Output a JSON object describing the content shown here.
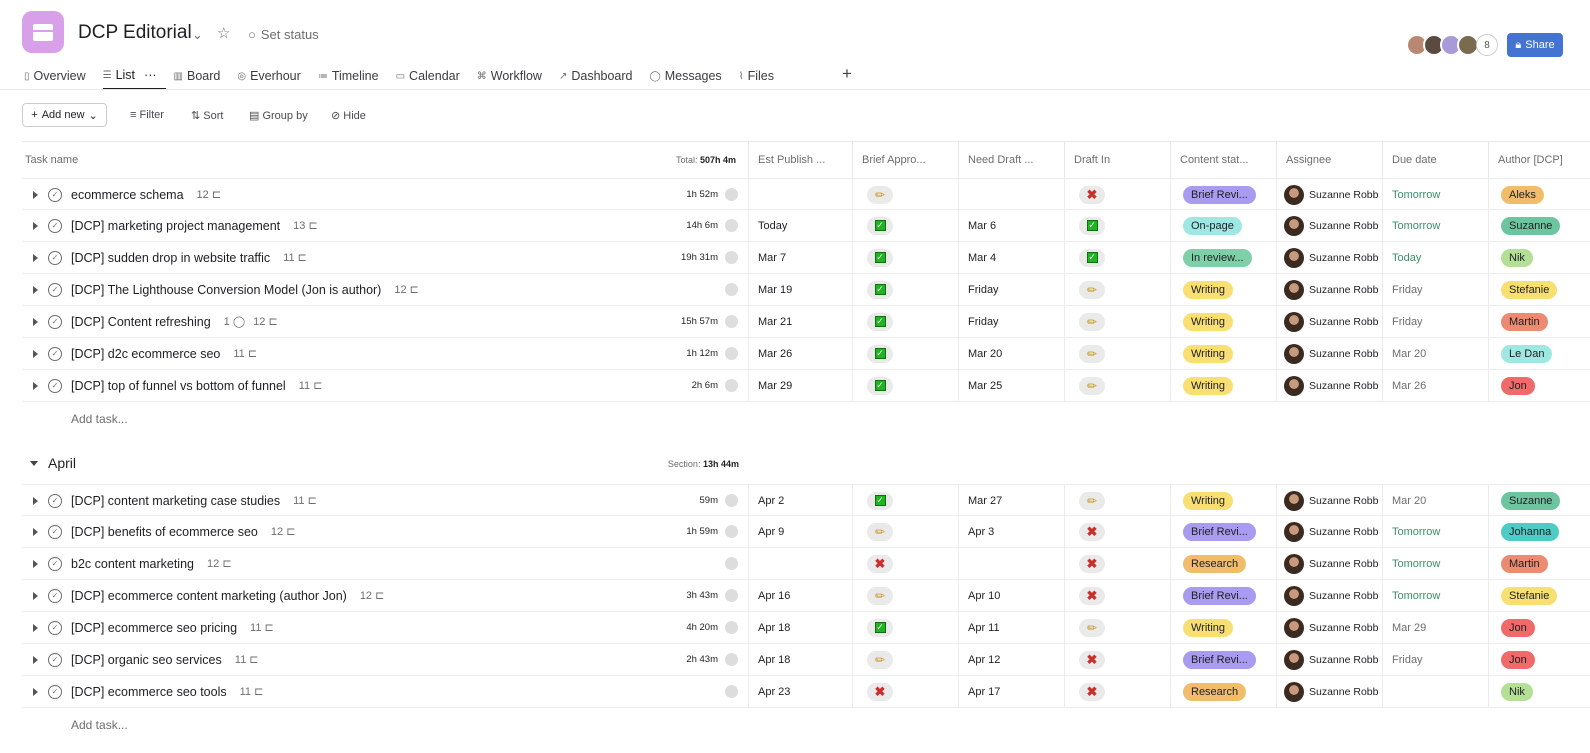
{
  "header": {
    "title": "DCP Editorial",
    "set_status": "Set status",
    "member_count": "8",
    "share": "Share"
  },
  "tabs": [
    {
      "label": "Overview",
      "icon": "clipboard-icon"
    },
    {
      "label": "List",
      "icon": "list-icon"
    },
    {
      "label": "Board",
      "icon": "board-icon"
    },
    {
      "label": "Everhour",
      "icon": "everhour-icon"
    },
    {
      "label": "Timeline",
      "icon": "timeline-icon"
    },
    {
      "label": "Calendar",
      "icon": "calendar-icon"
    },
    {
      "label": "Workflow",
      "icon": "workflow-icon"
    },
    {
      "label": "Dashboard",
      "icon": "dashboard-icon"
    },
    {
      "label": "Messages",
      "icon": "message-icon"
    },
    {
      "label": "Files",
      "icon": "paperclip-icon"
    }
  ],
  "active_tab": "List",
  "toolbar": {
    "add_new": "Add new",
    "filter": "Filter",
    "sort": "Sort",
    "group_by": "Group by",
    "hide": "Hide"
  },
  "columns": {
    "task_name": "Task name",
    "total_label": "Total:",
    "total": "507h 4m",
    "est_publish": "Est Publish ...",
    "brief": "Brief Appro...",
    "need_draft": "Need Draft ...",
    "draft_in": "Draft In",
    "content_status": "Content stat...",
    "assignee": "Assignee",
    "due": "Due date",
    "author": "Author [DCP]"
  },
  "status_colors": {
    "Brief Revi...": "#a99cf0",
    "On-page": "#9ee7e3",
    "In review...": "#7fcfa8",
    "Writing": "#f8df72",
    "Research": "#f1bd6c"
  },
  "author_colors": {
    "Aleks": "#f1bd6c",
    "Suzanne": "#6cc59e",
    "Nik": "#b3df97",
    "Stefanie": "#f8df72",
    "Martin": "#ec8a72",
    "Le Dan": "#9ee7e3",
    "Jon": "#f06a6a",
    "Johanna": "#4ecbc4"
  },
  "add_task": "Add task...",
  "sections": [
    {
      "name": "",
      "rows": [
        {
          "name": "ecommerce schema",
          "comments": "",
          "subtasks": "12",
          "time": "1h 52m",
          "publish": "",
          "brief": "pencil",
          "need": "",
          "draft": "x",
          "status": "Brief Revi...",
          "assignee": "Suzanne Robb",
          "due": "Tomorrow",
          "author": "Aleks"
        },
        {
          "name": "[DCP] marketing project management",
          "comments": "",
          "subtasks": "13",
          "time": "14h 6m",
          "publish": "Today",
          "brief": "check",
          "need": "Mar 6",
          "draft": "check",
          "status": "On-page",
          "assignee": "Suzanne Robb",
          "due": "Tomorrow",
          "author": "Suzanne"
        },
        {
          "name": "[DCP] sudden drop in website traffic",
          "comments": "",
          "subtasks": "11",
          "time": "19h 31m",
          "publish": "Mar 7",
          "brief": "check",
          "need": "Mar 4",
          "draft": "check",
          "status": "In review...",
          "assignee": "Suzanne Robb",
          "due": "Today",
          "author": "Nik"
        },
        {
          "name": "[DCP] The Lighthouse Conversion Model (Jon is author)",
          "comments": "",
          "subtasks": "12",
          "time": "",
          "publish": "Mar 19",
          "brief": "check",
          "need": "Friday",
          "draft": "pencil",
          "status": "Writing",
          "assignee": "Suzanne Robb",
          "due": "Friday",
          "author": "Stefanie"
        },
        {
          "name": "[DCP] Content refreshing",
          "comments": "1",
          "subtasks": "12",
          "time": "15h 57m",
          "publish": "Mar 21",
          "brief": "check",
          "need": "Friday",
          "draft": "pencil",
          "status": "Writing",
          "assignee": "Suzanne Robb",
          "due": "Friday",
          "author": "Martin"
        },
        {
          "name": "[DCP] d2c ecommerce seo",
          "comments": "",
          "subtasks": "11",
          "time": "1h 12m",
          "publish": "Mar 26",
          "brief": "check",
          "need": "Mar 20",
          "draft": "pencil",
          "status": "Writing",
          "assignee": "Suzanne Robb",
          "due": "Mar 20",
          "author": "Le Dan"
        },
        {
          "name": "[DCP] top of funnel vs bottom of funnel",
          "comments": "",
          "subtasks": "11",
          "time": "2h 6m",
          "publish": "Mar 29",
          "brief": "check",
          "need": "Mar 25",
          "draft": "pencil",
          "status": "Writing",
          "assignee": "Suzanne Robb",
          "due": "Mar 26",
          "author": "Jon"
        }
      ]
    },
    {
      "name": "April",
      "total_label": "Section:",
      "total": "13h 44m",
      "rows": [
        {
          "name": "[DCP] content marketing case studies",
          "comments": "",
          "subtasks": "11",
          "time": "59m",
          "publish": "Apr 2",
          "brief": "check",
          "need": "Mar 27",
          "draft": "pencil",
          "status": "Writing",
          "assignee": "Suzanne Robb",
          "due": "Mar 20",
          "author": "Suzanne"
        },
        {
          "name": "[DCP] benefits of ecommerce seo",
          "comments": "",
          "subtasks": "12",
          "time": "1h 59m",
          "publish": "Apr 9",
          "brief": "pencil",
          "need": "Apr 3",
          "draft": "x",
          "status": "Brief Revi...",
          "assignee": "Suzanne Robb",
          "due": "Tomorrow",
          "author": "Johanna"
        },
        {
          "name": "b2c content marketing",
          "comments": "",
          "subtasks": "12",
          "time": "",
          "publish": "",
          "brief": "x",
          "need": "",
          "draft": "x",
          "status": "Research",
          "assignee": "Suzanne Robb",
          "due": "Tomorrow",
          "author": "Martin"
        },
        {
          "name": "[DCP] ecommerce content marketing (author Jon)",
          "comments": "",
          "subtasks": "12",
          "time": "3h 43m",
          "publish": "Apr 16",
          "brief": "pencil",
          "need": "Apr 10",
          "draft": "x",
          "status": "Brief Revi...",
          "assignee": "Suzanne Robb",
          "due": "Tomorrow",
          "author": "Stefanie"
        },
        {
          "name": "[DCP] ecommerce seo pricing",
          "comments": "",
          "subtasks": "11",
          "time": "4h 20m",
          "publish": "Apr 18",
          "brief": "check",
          "need": "Apr 11",
          "draft": "pencil",
          "status": "Writing",
          "assignee": "Suzanne Robb",
          "due": "Mar 29",
          "author": "Jon"
        },
        {
          "name": "[DCP] organic seo services",
          "comments": "",
          "subtasks": "11",
          "time": "2h 43m",
          "publish": "Apr 18",
          "brief": "pencil",
          "need": "Apr 12",
          "draft": "x",
          "status": "Brief Revi...",
          "assignee": "Suzanne Robb",
          "due": "Friday",
          "author": "Jon"
        },
        {
          "name": "[DCP] ecommerce seo tools",
          "comments": "",
          "subtasks": "11",
          "time": "",
          "publish": "Apr 23",
          "brief": "x",
          "need": "Apr 17",
          "draft": "x",
          "status": "Research",
          "assignee": "Suzanne Robb",
          "due": "",
          "author": "Nik"
        }
      ]
    }
  ]
}
